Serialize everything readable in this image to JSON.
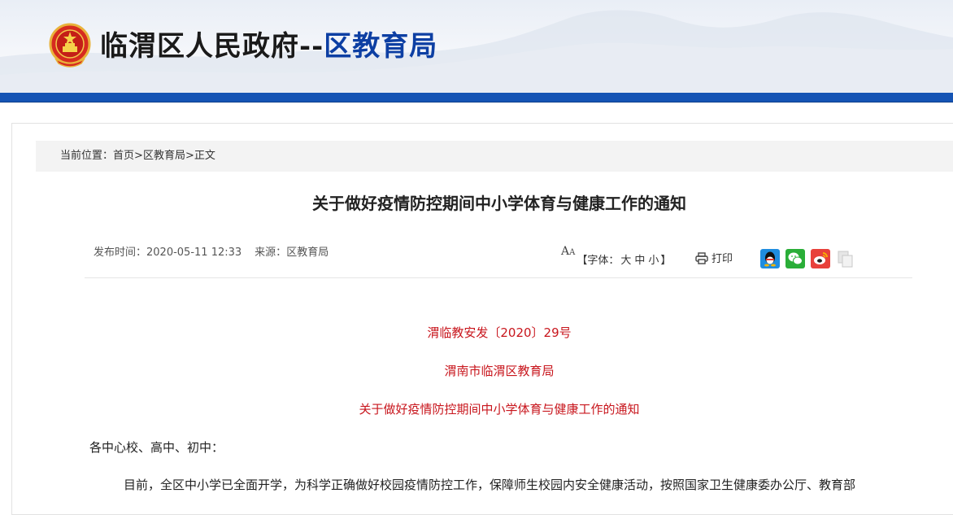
{
  "header": {
    "site_name": "临渭区人民政府",
    "separator": "--",
    "dept_name": "区教育局"
  },
  "breadcrumb": {
    "prefix": "当前位置：",
    "home": "首页",
    "section": "区教育局",
    "current": "正文",
    "sep": ">"
  },
  "article": {
    "title": "关于做好疫情防控期间中小学体育与健康工作的通知",
    "publish_label": "发布时间：",
    "publish_time": "2020-05-11 12:33",
    "source_label": "来源：",
    "source": "区教育局",
    "doc_number": "渭临教安发〔2020〕29号",
    "issuer": "渭南市临渭区教育局",
    "notice_title": "关于做好疫情防控期间中小学体育与健康工作的通知",
    "addressee": "各中心校、高中、初中：",
    "paragraph1": "目前，全区中小学已全面开学，为科学正确做好校园疫情防控工作，保障师生校园内安全健康活动，按照国家卫生健康委办公厅、教育部"
  },
  "toolbar": {
    "font_label_prefix": "【字体：",
    "font_large": "大",
    "font_medium": "中",
    "font_small": "小",
    "font_label_suffix": "】",
    "print_label": "打印"
  },
  "share": [
    "qq-icon",
    "wechat-icon",
    "weibo-icon",
    "copy-icon"
  ],
  "colors": {
    "accent_blue": "#1554b4",
    "dept_blue": "#0d3fa3",
    "red_text": "#c8161d"
  }
}
